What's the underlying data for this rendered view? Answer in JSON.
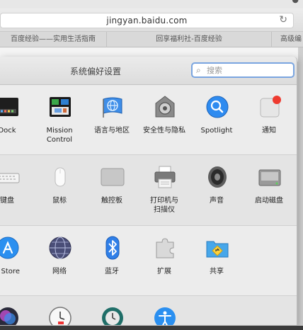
{
  "browser": {
    "url": "jingyan.baidu.com",
    "tabs": [
      "百度经验——实用生活指南",
      "回享福利社-百度经验",
      "高级编"
    ]
  },
  "prefs": {
    "title": "系统偏好设置",
    "search_placeholder": "搜索",
    "row1": [
      {
        "label": "Dock",
        "icon": "dock-icon"
      },
      {
        "label": "Mission",
        "label2": "Control",
        "icon": "mission-control-icon"
      },
      {
        "label": "语言与地区",
        "icon": "language-region-icon"
      },
      {
        "label": "安全性与隐私",
        "icon": "security-privacy-icon"
      },
      {
        "label": "Spotlight",
        "icon": "spotlight-icon"
      },
      {
        "label": "通知",
        "icon": "notifications-icon"
      }
    ],
    "row2": [
      {
        "label": "键盘",
        "icon": "keyboard-icon"
      },
      {
        "label": "鼠标",
        "icon": "mouse-icon"
      },
      {
        "label": "触控板",
        "icon": "trackpad-icon"
      },
      {
        "label": "打印机与",
        "label2": "扫描仪",
        "icon": "printer-scanner-icon"
      },
      {
        "label": "声音",
        "icon": "sound-icon"
      },
      {
        "label": "启动磁盘",
        "icon": "startup-disk-icon"
      }
    ],
    "row3": [
      {
        "label": "p Store",
        "icon": "app-store-icon"
      },
      {
        "label": "网络",
        "icon": "network-icon"
      },
      {
        "label": "蓝牙",
        "icon": "bluetooth-icon"
      },
      {
        "label": "扩展",
        "icon": "extensions-icon"
      },
      {
        "label": "共享",
        "icon": "sharing-icon"
      }
    ],
    "row4": [
      {
        "icon": "siri-icon"
      },
      {
        "icon": "date-time-icon"
      },
      {
        "icon": "time-machine-icon"
      },
      {
        "icon": "accessibility-icon"
      }
    ]
  }
}
